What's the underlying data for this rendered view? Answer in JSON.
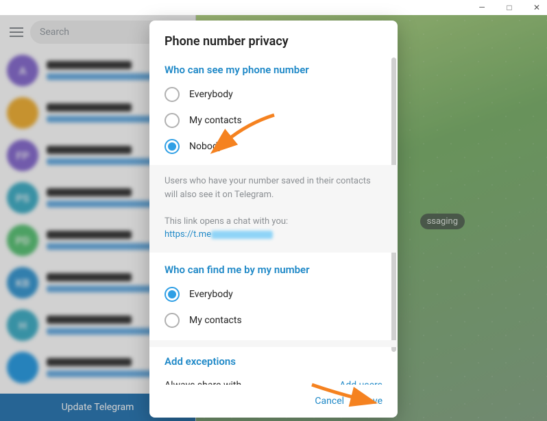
{
  "window": {
    "minimize": "—",
    "maximize": "□",
    "close": "✕"
  },
  "search": {
    "placeholder": "Search"
  },
  "chats": {
    "items": [
      {
        "initials": "A",
        "color": "#8a6fd1"
      },
      {
        "initials": "",
        "color": "#f2b33a"
      },
      {
        "initials": "FP",
        "color": "#8a6fd1"
      },
      {
        "initials": "PS",
        "color": "#45b1c9"
      },
      {
        "initials": "PD",
        "color": "#5fc57a"
      },
      {
        "initials": "KB",
        "color": "#3d9bd4"
      },
      {
        "initials": "H",
        "color": "#45b1c9"
      },
      {
        "initials": "",
        "color": "#2f9fe5"
      }
    ]
  },
  "update_banner": "Update Telegram",
  "right_badge": "ssaging",
  "dialog": {
    "title": "Phone number privacy",
    "see_section": "Who can see my phone number",
    "opt_everybody": "Everybody",
    "opt_mycontacts": "My contacts",
    "opt_nobody": "Nobody",
    "info1": "Users who have your number saved in their contacts will also see it on Telegram.",
    "info2": "This link opens a chat with you:",
    "link_prefix": "https://t.me",
    "find_section": "Who can find me by my number",
    "exc_section": "Add exceptions",
    "always_share": "Always share with",
    "add_users": "Add users",
    "cancel": "Cancel",
    "save": "Save"
  }
}
